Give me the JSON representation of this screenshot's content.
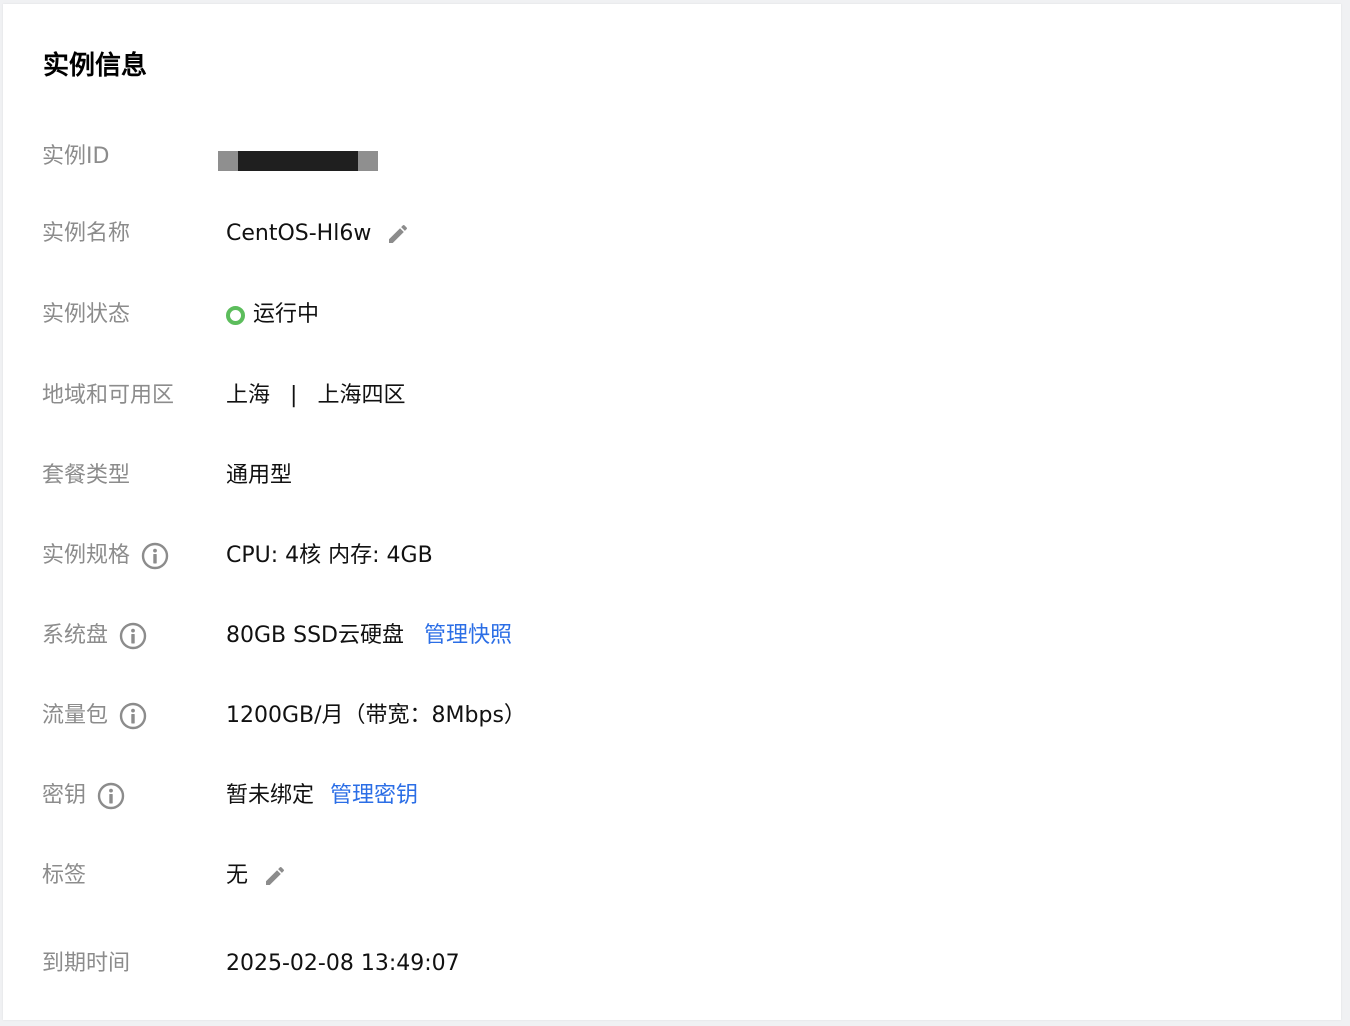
{
  "title": "实例信息",
  "rows": {
    "id": {
      "label": "实例ID"
    },
    "name": {
      "label": "实例名称",
      "value": "CentOS-Hl6w"
    },
    "status": {
      "label": "实例状态",
      "value": "运行中",
      "status_color": "#5cbd5c"
    },
    "region": {
      "label": "地域和可用区",
      "region": "上海",
      "separator": "|",
      "zone": "上海四区"
    },
    "package": {
      "label": "套餐类型",
      "value": "通用型"
    },
    "spec": {
      "label": "实例规格",
      "value": "CPU: 4核 内存: 4GB"
    },
    "disk": {
      "label": "系统盘",
      "value": "80GB SSD云硬盘",
      "link": "管理快照"
    },
    "traffic": {
      "label": "流量包",
      "value": "1200GB/月（带宽：8Mbps）"
    },
    "key": {
      "label": "密钥",
      "value": "暂未绑定",
      "link": "管理密钥"
    },
    "tags": {
      "label": "标签",
      "value": "无"
    },
    "expire": {
      "label": "到期时间",
      "value": "2025-02-08 13:49:07"
    }
  },
  "colors": {
    "label": "#8c8c8c",
    "value": "#111111",
    "link": "#2b6ee6",
    "icon": "#8c8c8c"
  },
  "icons": {
    "edit": "pencil-icon",
    "info": "info-circle-icon",
    "status": "status-ring-icon"
  }
}
